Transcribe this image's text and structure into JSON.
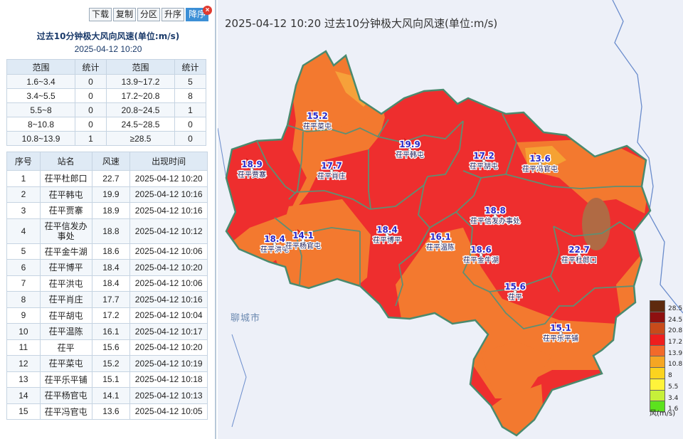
{
  "toolbar": {
    "download": "下载",
    "copy": "复制",
    "partition": "分区",
    "asc": "升序",
    "desc": "降序",
    "close_icon": "close-icon"
  },
  "panel": {
    "title": "过去10分钟极大风向风速(单位:m/s)",
    "time": "2025-04-12 10:20"
  },
  "stats": {
    "headers": [
      "范围",
      "统计",
      "范围",
      "统计"
    ],
    "rows": [
      [
        "1.6~3.4",
        "0",
        "13.9~17.2",
        "5"
      ],
      [
        "3.4~5.5",
        "0",
        "17.2~20.8",
        "8"
      ],
      [
        "5.5~8",
        "0",
        "20.8~24.5",
        "1"
      ],
      [
        "8~10.8",
        "0",
        "24.5~28.5",
        "0"
      ],
      [
        "10.8~13.9",
        "1",
        "≥28.5",
        "0"
      ]
    ]
  },
  "stations": {
    "headers": [
      "序号",
      "站名",
      "风速",
      "出现时间"
    ],
    "rows": [
      [
        "1",
        "茌平杜郎口",
        "22.7",
        "2025-04-12 10:20"
      ],
      [
        "2",
        "茌平韩屯",
        "19.9",
        "2025-04-12 10:16"
      ],
      [
        "3",
        "茌平贾寨",
        "18.9",
        "2025-04-12 10:16"
      ],
      [
        "4",
        "茌平信发办事处",
        "18.8",
        "2025-04-12 10:12"
      ],
      [
        "5",
        "茌平金牛湖",
        "18.6",
        "2025-04-12 10:06"
      ],
      [
        "6",
        "茌平博平",
        "18.4",
        "2025-04-12 10:20"
      ],
      [
        "7",
        "茌平洪屯",
        "18.4",
        "2025-04-12 10:06"
      ],
      [
        "8",
        "茌平肖庄",
        "17.7",
        "2025-04-12 10:16"
      ],
      [
        "9",
        "茌平胡屯",
        "17.2",
        "2025-04-12 10:04"
      ],
      [
        "10",
        "茌平温陈",
        "16.1",
        "2025-04-12 10:17"
      ],
      [
        "11",
        "茌平",
        "15.6",
        "2025-04-12 10:20"
      ],
      [
        "12",
        "茌平菜屯",
        "15.2",
        "2025-04-12 10:19"
      ],
      [
        "13",
        "茌平乐平铺",
        "15.1",
        "2025-04-12 10:18"
      ],
      [
        "14",
        "茌平杨官屯",
        "14.1",
        "2025-04-12 10:13"
      ],
      [
        "15",
        "茌平冯官屯",
        "13.6",
        "2025-04-12 10:05"
      ]
    ]
  },
  "map": {
    "title": "2025-04-12 10:20 过去10分钟极大风向风速(单位:m/s)",
    "city_label": "聊城市",
    "markers": [
      {
        "value": "15.2",
        "name": "茌平菜屯"
      },
      {
        "value": "18.9",
        "name": "茌平贾寨"
      },
      {
        "value": "17.7",
        "name": "茌平肖庄"
      },
      {
        "value": "19.9",
        "name": "茌平韩屯"
      },
      {
        "value": "17.2",
        "name": "茌平胡屯"
      },
      {
        "value": "13.6",
        "name": "茌平冯官屯"
      },
      {
        "value": "18.8",
        "name": "茌平信发办事处"
      },
      {
        "value": "18.4",
        "name": "茌平洪屯"
      },
      {
        "value": "14.1",
        "name": "茌平杨官屯"
      },
      {
        "value": "18.4",
        "name": "茌平博平"
      },
      {
        "value": "16.1",
        "name": "茌平温陈"
      },
      {
        "value": "18.6",
        "name": "茌平金牛湖"
      },
      {
        "value": "22.7",
        "name": "茌平杜郎口"
      },
      {
        "value": "15.6",
        "name": "茌平"
      },
      {
        "value": "15.1",
        "name": "茌平乐平铺"
      }
    ]
  },
  "legend": {
    "unit": "风(m/s)",
    "levels": [
      {
        "label": "28.5",
        "color": "#5e2a0e"
      },
      {
        "label": "24.5",
        "color": "#8e1010"
      },
      {
        "label": "20.8",
        "color": "#c84a1a"
      },
      {
        "label": "17.2",
        "color": "#ee1e1e"
      },
      {
        "label": "13.9",
        "color": "#f26a2a"
      },
      {
        "label": "10.8",
        "color": "#f5a623"
      },
      {
        "label": "8",
        "color": "#fbd31f"
      },
      {
        "label": "5.5",
        "color": "#fff33b"
      },
      {
        "label": "3.4",
        "color": "#c6f03a"
      },
      {
        "label": "1.6",
        "color": "#5ce21e"
      }
    ]
  },
  "colors": {
    "zone_red": "#ee2e2e",
    "zone_orange": "#f3792f",
    "zone_light_orange": "#f6a13a",
    "zone_dark": "#b06a44",
    "border": "#4a8a6e",
    "river": "#6a8ccc",
    "background": "#edf0f8"
  }
}
